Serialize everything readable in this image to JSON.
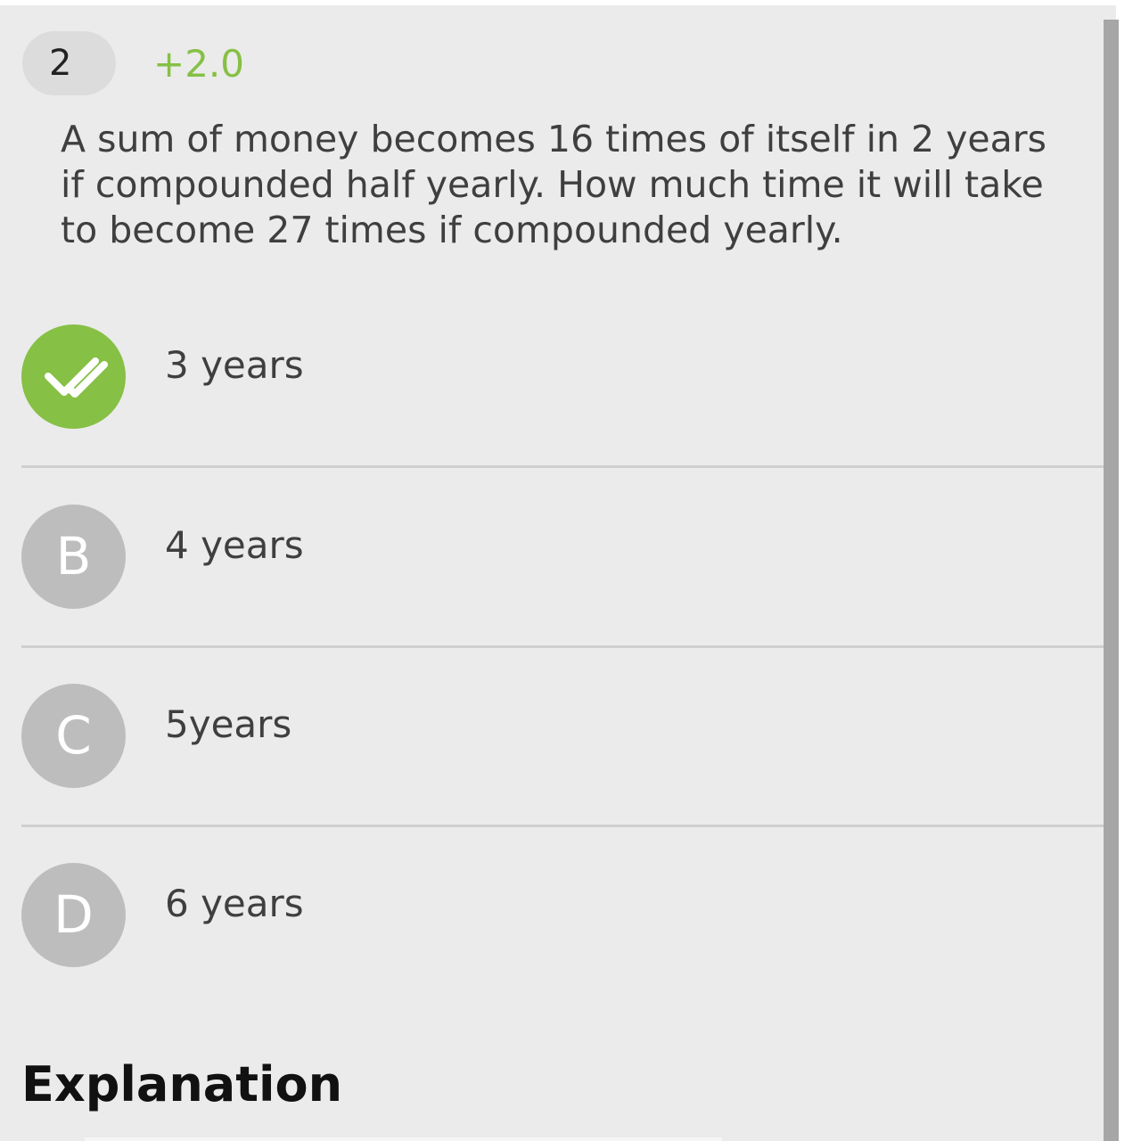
{
  "question": {
    "number": "2",
    "marks": "+2.0",
    "text": "A sum of money becomes 16 times of itself in 2 years if compounded half yearly. How much time it will take to become 27 times if compounded yearly."
  },
  "options": [
    {
      "badge": "",
      "icon": "double-check-icon",
      "text": "3 years",
      "state": "correct"
    },
    {
      "badge": "B",
      "text": "4 years",
      "state": "unselected"
    },
    {
      "badge": "C",
      "text": "5years",
      "state": "unselected"
    },
    {
      "badge": "D",
      "text": "6 years",
      "state": "unselected"
    }
  ],
  "explanation": {
    "heading": "Explanation"
  },
  "colors": {
    "correct": "#86c045",
    "neutral_badge": "#bdbdbd",
    "background": "#ebebeb"
  }
}
